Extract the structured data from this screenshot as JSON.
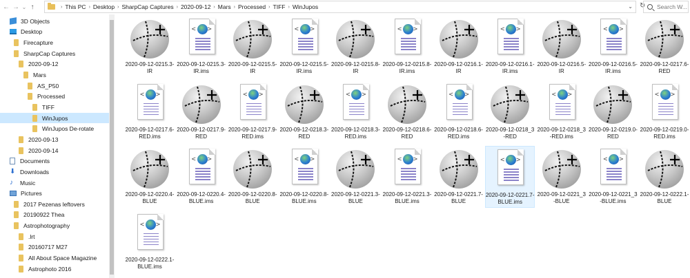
{
  "nav": {
    "back_icon": "back-arrow-icon",
    "forward_icon": "forward-arrow-icon",
    "recent_icon": "chevron-down-icon",
    "up_icon": "up-arrow-icon"
  },
  "breadcrumb": [
    "This PC",
    "Desktop",
    "SharpCap Captures",
    "2020-09-12",
    "Mars",
    "Processed",
    "TIFF",
    "WinJupos"
  ],
  "search": {
    "placeholder": "Search W..."
  },
  "sidebar": {
    "items": [
      {
        "label": "3D Objects",
        "icon": "3d-objects-icon",
        "indent": 14
      },
      {
        "label": "Desktop",
        "icon": "desktop-icon",
        "indent": 14
      },
      {
        "label": "Firecapture",
        "icon": "folder-icon",
        "indent": 20
      },
      {
        "label": "SharpCap Captures",
        "icon": "folder-icon",
        "indent": 20
      },
      {
        "label": "2020-09-12",
        "icon": "folder-icon",
        "indent": 27
      },
      {
        "label": "Mars",
        "icon": "folder-icon",
        "indent": 34
      },
      {
        "label": "AS_P50",
        "icon": "folder-icon",
        "indent": 40
      },
      {
        "label": "Processed",
        "icon": "folder-icon",
        "indent": 40
      },
      {
        "label": "TIFF",
        "icon": "folder-icon",
        "indent": 47
      },
      {
        "label": "WinJupos",
        "icon": "folder-icon",
        "indent": 47,
        "selected": true
      },
      {
        "label": "WinJupos De-rotate",
        "icon": "folder-icon",
        "indent": 47
      },
      {
        "label": "2020-09-13",
        "icon": "folder-icon",
        "indent": 27
      },
      {
        "label": "2020-09-14",
        "icon": "folder-icon",
        "indent": 27
      },
      {
        "label": "Documents",
        "icon": "documents-icon",
        "indent": 14
      },
      {
        "label": "Downloads",
        "icon": "downloads-icon",
        "indent": 14
      },
      {
        "label": "Music",
        "icon": "music-icon",
        "indent": 14
      },
      {
        "label": "Pictures",
        "icon": "pictures-icon",
        "indent": 14
      },
      {
        "label": "2017 Pezenas leftovers",
        "icon": "folder-icon",
        "indent": 20
      },
      {
        "label": "20190922 Thea",
        "icon": "folder-icon",
        "indent": 20
      },
      {
        "label": "Astrophotography",
        "icon": "folder-icon",
        "indent": 20
      },
      {
        "label": ".lrt",
        "icon": "folder-icon",
        "indent": 27
      },
      {
        "label": "20160717 M27",
        "icon": "folder-icon",
        "indent": 27
      },
      {
        "label": "All About Space Magazine",
        "icon": "folder-icon",
        "indent": 27
      },
      {
        "label": "Astrophoto 2016",
        "icon": "folder-icon",
        "indent": 27
      }
    ]
  },
  "files": [
    {
      "name": "2020-09-12-0215.3-IR",
      "type": "sphere"
    },
    {
      "name": "2020-09-12-0215.3-IR.ims",
      "type": "page"
    },
    {
      "name": "2020-09-12-0215.5-IR",
      "type": "sphere"
    },
    {
      "name": "2020-09-12-0215.5-IR.ims",
      "type": "page"
    },
    {
      "name": "2020-09-12-0215.8-IR",
      "type": "sphere"
    },
    {
      "name": "2020-09-12-0215.8-IR.ims",
      "type": "page"
    },
    {
      "name": "2020-09-12-0216.1-IR",
      "type": "sphere"
    },
    {
      "name": "2020-09-12-0216.1-IR.ims",
      "type": "page"
    },
    {
      "name": "2020-09-12-0216.5-IR",
      "type": "sphere"
    },
    {
      "name": "2020-09-12-0216.5-IR.ims",
      "type": "page"
    },
    {
      "name": "2020-09-12-0217.6-RED",
      "type": "sphere"
    },
    {
      "name": "2020-09-12-0217.6-RED.ims",
      "type": "page"
    },
    {
      "name": "2020-09-12-0217.9-RED",
      "type": "sphere"
    },
    {
      "name": "2020-09-12-0217.9-RED.ims",
      "type": "page"
    },
    {
      "name": "2020-09-12-0218.3-RED",
      "type": "sphere"
    },
    {
      "name": "2020-09-12-0218.3-RED.ims",
      "type": "page"
    },
    {
      "name": "2020-09-12-0218.6-RED",
      "type": "sphere"
    },
    {
      "name": "2020-09-12-0218.6-RED.ims",
      "type": "page"
    },
    {
      "name": "2020-09-12-0218_3-RED",
      "type": "sphere"
    },
    {
      "name": "2020-09-12-0218_3-RED.ims",
      "type": "page"
    },
    {
      "name": "2020-09-12-0219.0-RED",
      "type": "sphere"
    },
    {
      "name": "2020-09-12-0219.0-RED.ims",
      "type": "page"
    },
    {
      "name": "2020-09-12-0220.4-BLUE",
      "type": "sphere"
    },
    {
      "name": "2020-09-12-0220.4-BLUE.ims",
      "type": "page"
    },
    {
      "name": "2020-09-12-0220.8-BLUE",
      "type": "sphere"
    },
    {
      "name": "2020-09-12-0220.8-BLUE.ims",
      "type": "page"
    },
    {
      "name": "2020-09-12-0221.3-BLUE",
      "type": "sphere"
    },
    {
      "name": "2020-09-12-0221.3-BLUE.ims",
      "type": "page"
    },
    {
      "name": "2020-09-12-0221.7-BLUE",
      "type": "sphere"
    },
    {
      "name": "2020-09-12-0221.7-BLUE.ims",
      "type": "page",
      "selected": true
    },
    {
      "name": "2020-09-12-0221_3-BLUE",
      "type": "sphere"
    },
    {
      "name": "2020-09-12-0221_3-BLUE.ims",
      "type": "page"
    },
    {
      "name": "2020-09-12-0222.1-BLUE",
      "type": "sphere"
    },
    {
      "name": "2020-09-12-0222.1-BLUE.ims",
      "type": "page"
    }
  ],
  "colors": {
    "selection": "#cce8ff",
    "folder": "#e9c35f"
  }
}
